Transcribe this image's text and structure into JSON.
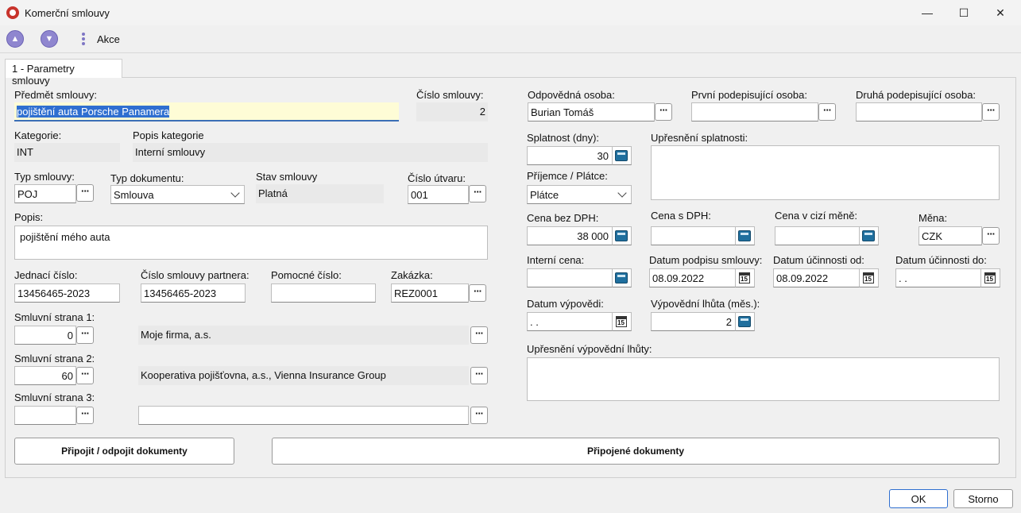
{
  "window": {
    "title": "Komerční smlouvy"
  },
  "toolbar": {
    "akce": "Akce"
  },
  "tab": {
    "label": "1 - Parametry smlouvy"
  },
  "form": {
    "predmet_label": "Předmět smlouvy:",
    "predmet_value": "pojištění auta Porsche Panamera",
    "cislo_label": "Číslo smlouvy:",
    "cislo_value": "2",
    "kategorie_label": "Kategorie:",
    "kategorie_value": "INT",
    "popis_kat_label": "Popis kategorie",
    "popis_kat_value": "Interní smlouvy",
    "typ_smlouvy_label": "Typ smlouvy:",
    "typ_smlouvy_value": "POJ",
    "typ_dok_label": "Typ dokumentu:",
    "typ_dok_value": "Smlouva",
    "stav_label": "Stav smlouvy",
    "stav_value": "Platná",
    "utvar_label": "Číslo útvaru:",
    "utvar_value": "001",
    "popis_label": "Popis:",
    "popis_value": "pojištění mého auta",
    "jednaci_label": "Jednací číslo:",
    "jednaci_value": "13456465-2023",
    "partner_label": "Číslo smlouvy partnera:",
    "partner_value": "13456465-2023",
    "pomocne_label": "Pomocné číslo:",
    "pomocne_value": "",
    "zakazka_label": "Zakázka:",
    "zakazka_value": "REZ0001",
    "strana1_label": "Smluvní strana 1:",
    "strana1_id": "0",
    "strana1_name": "Moje firma, a.s.",
    "strana2_label": "Smluvní strana 2:",
    "strana2_id": "60",
    "strana2_name": "Kooperativa pojišťovna, a.s., Vienna Insurance Group",
    "strana3_label": "Smluvní strana 3:",
    "strana3_id": "",
    "strana3_name": "",
    "odpovedna_label": "Odpovědná osoba:",
    "odpovedna_value": "Burian Tomáš",
    "prvni_label": "První podepisující osoba:",
    "prvni_value": "",
    "druha_label": "Druhá podepisující osoba:",
    "druha_value": "",
    "splatnost_label": "Splatnost (dny):",
    "splatnost_value": "30",
    "upresneni_spl_label": "Upřesnění splatnosti:",
    "upresneni_spl_value": "",
    "prijemce_label": "Příjemce / Plátce:",
    "prijemce_value": "Plátce",
    "cena_bez_label": "Cena bez DPH:",
    "cena_bez_value": "38 000",
    "cena_s_label": "Cena s DPH:",
    "cena_s_value": "",
    "cena_ciz_label": "Cena v cizí měně:",
    "cena_ciz_value": "",
    "mena_label": "Měna:",
    "mena_value": "CZK",
    "interni_label": "Interní cena:",
    "interni_value": "",
    "podpis_label": "Datum podpisu smlouvy:",
    "podpis_value": "08.09.2022",
    "ucinnost_od_label": "Datum účinnosti od:",
    "ucinnost_od_value": "08.09.2022",
    "ucinnost_do_label": "Datum účinnosti do:",
    "ucinnost_do_value": " .  .",
    "vypoved_label": "Datum výpovědi:",
    "vypoved_value": " .  .",
    "lhuta_label": "Výpovědní lhůta (měs.):",
    "lhuta_value": "2",
    "upresneni_vyp_label": "Upřesnění výpovědní lhůty:",
    "upresneni_vyp_value": ""
  },
  "buttons": {
    "pripojit": "Připojit / odpojit dokumenty",
    "pripojene": "Připojené dokumenty",
    "ok": "OK",
    "storno": "Storno"
  },
  "colors": {
    "accent": "#2f6fd0",
    "highlight": "#fefcd6"
  }
}
